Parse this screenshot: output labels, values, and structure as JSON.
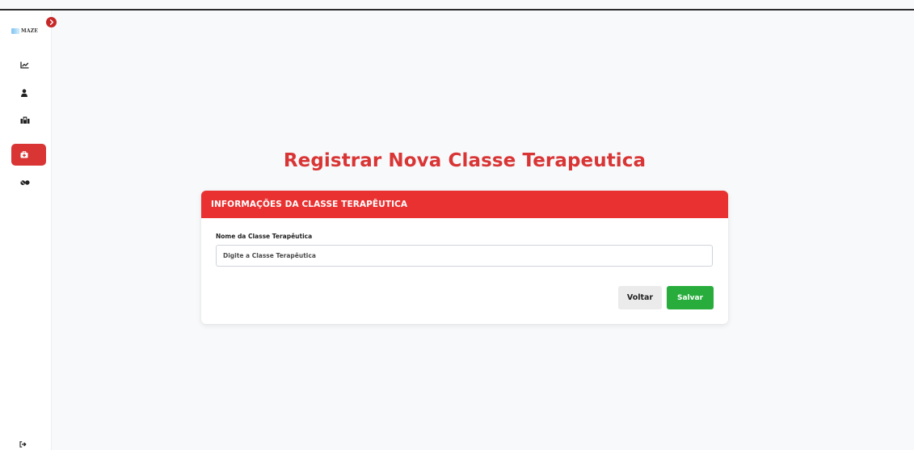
{
  "sidebar": {
    "brand": {
      "text": "MAZE"
    },
    "items": [
      {
        "icon": "chart-line-icon",
        "active": false
      },
      {
        "icon": "user-icon",
        "active": false
      },
      {
        "icon": "users-group-icon",
        "active": false
      },
      {
        "icon": "medkit-icon",
        "active": true
      },
      {
        "icon": "pills-icon",
        "active": false
      }
    ],
    "logout_icon": "sign-out-icon",
    "toggle_icon": "chevron-right-icon"
  },
  "main": {
    "title": "Registrar Nova Classe Terapeutica",
    "card": {
      "header": "INFORMAÇÕES DA CLASSE TERAPÊUTICA",
      "field_label": "Nome da Classe Terapêutica",
      "field_placeholder": "Digite a Classe Terapêutica",
      "field_value": "",
      "back_label": "Voltar",
      "save_label": "Salvar"
    }
  },
  "colors": {
    "accent": "#d93535",
    "header": "#ea3131",
    "save": "#28ad3c",
    "back": "#ebebeb"
  }
}
